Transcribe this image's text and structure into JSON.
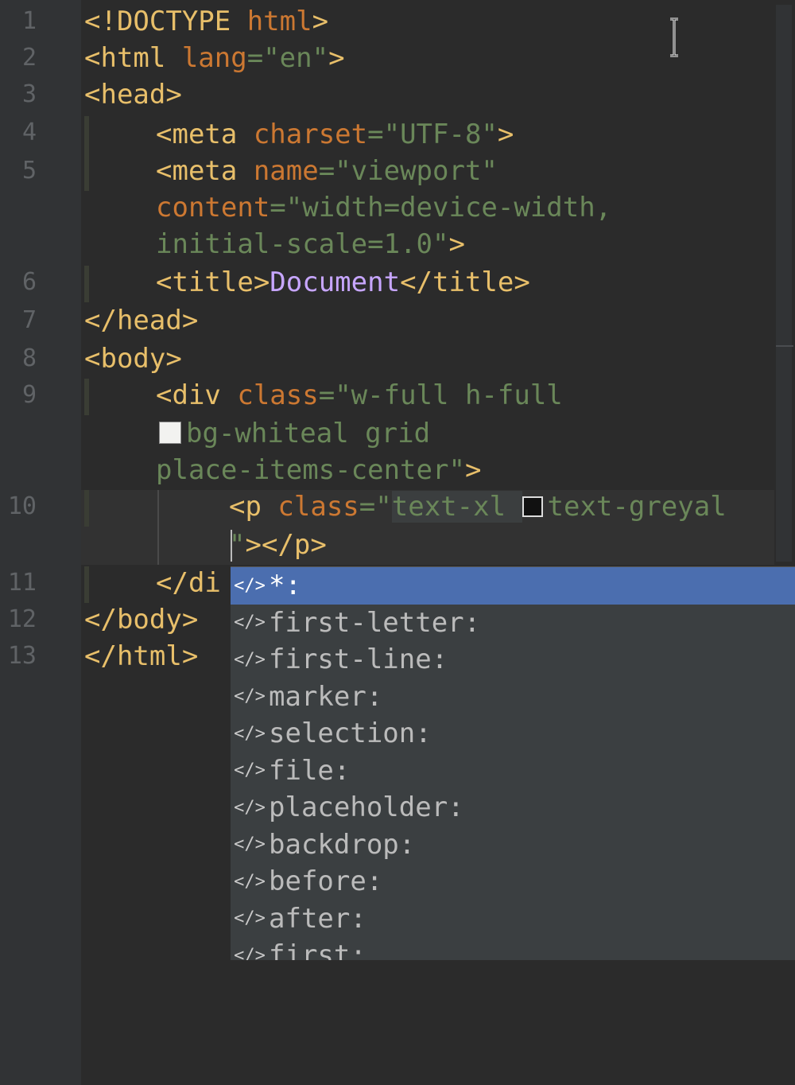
{
  "line_numbers": [
    "1",
    "2",
    "3",
    "4",
    "5",
    "6",
    "7",
    "8",
    "9",
    "10",
    "11",
    "12",
    "13"
  ],
  "lines": {
    "l1": {
      "a": "<!DOCTYPE ",
      "b": "html",
      "c": ">"
    },
    "l2": {
      "a": "<html ",
      "b": "lang",
      "c": "=",
      "d": "\"en\"",
      "e": ">"
    },
    "l3": {
      "a": "<head>"
    },
    "l4": {
      "a": "<meta ",
      "b": "charset",
      "c": "=",
      "d": "\"UTF-8\"",
      "e": ">"
    },
    "l5": {
      "a": "<meta ",
      "b": "name",
      "c": "=",
      "d": "\"viewport\""
    },
    "l5b": {
      "a": "content",
      "b": "=",
      "c": "\"width=device-width,"
    },
    "l5c": {
      "a": "initial-scale=1.0\"",
      "b": ">"
    },
    "l6": {
      "a": "<title>",
      "b": "Document",
      "c": "</title>"
    },
    "l7": {
      "a": "</head>"
    },
    "l8": {
      "a": "<body>"
    },
    "l9": {
      "a": "<div ",
      "b": "class",
      "c": "=",
      "d": "\"w-full h-full"
    },
    "l9b": {
      "a": "bg-whiteal grid"
    },
    "l9c": {
      "a": "place-items-center\"",
      "b": ">"
    },
    "l10": {
      "a": "<p ",
      "b": "class",
      "c": "=",
      "d": "\"",
      "e": "text-xl ",
      "f": "text-greyal"
    },
    "l10b": {
      "a": "\"",
      "b": ">",
      "c": "</p>"
    },
    "l11": {
      "a": "</di"
    },
    "l12": {
      "a": "</body>"
    },
    "l13": {
      "a": "</html>"
    }
  },
  "swatches": {
    "white": "#f2f2f0",
    "black": "#111111"
  },
  "completion": {
    "icon": "code-tag-icon",
    "items": [
      "*:",
      "first-letter:",
      "first-line:",
      "marker:",
      "selection:",
      "file:",
      "placeholder:",
      "backdrop:",
      "before:",
      "after:",
      "first:"
    ],
    "selected_index": 0
  },
  "colors": {
    "tag": "#e8bf6a",
    "attr": "#cc7832",
    "string": "#6a8759",
    "selection": "#4b6eaf",
    "background": "#2b2b2b"
  }
}
